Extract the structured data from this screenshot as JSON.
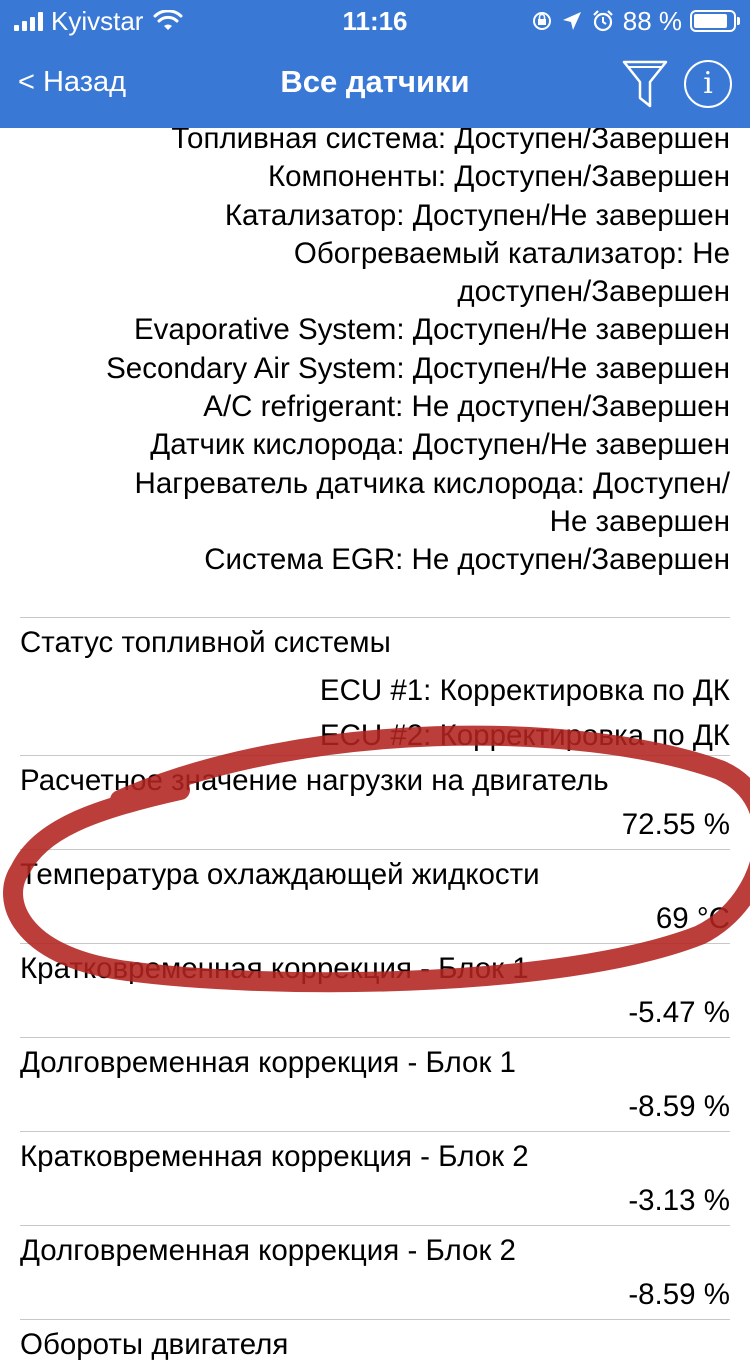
{
  "status_bar": {
    "carrier": "Kyivstar",
    "time": "11:16",
    "battery": "88 %",
    "battery_level": 0.88
  },
  "nav": {
    "back_label": "< Назад",
    "title": "Все датчики",
    "icons": [
      "filter-icon",
      "info-icon"
    ]
  },
  "monitors": [
    "Топливная система: Доступен/Завершен",
    "Компоненты: Доступен/Завершен",
    "Катализатор: Доступен/Не завершен",
    "Обогреваемый катализатор: Не",
    "доступен/Завершен",
    "Evaporative System: Доступен/Не завершен",
    "Secondary Air System: Доступен/Не завершен",
    "A/C refrigerant: Не доступен/Завершен",
    "Датчик кислорода: Доступен/Не завершен",
    "Нагреватель датчика кислорода: Доступен/",
    "Не завершен",
    "Система EGR: Не доступен/Завершен"
  ],
  "sensors": [
    {
      "label": "Статус топливной системы",
      "value": [
        "ECU #1: Корректировка по ДК",
        "ECU #2: Корректировка по ДК"
      ]
    },
    {
      "label": "Расчетное значение нагрузки на двигатель",
      "value": "72.55 %"
    },
    {
      "label": "Температура охлаждающей жидкости",
      "value": "69 °C"
    },
    {
      "label": "Кратковременная коррекция - Блок 1",
      "value": "-5.47 %"
    },
    {
      "label": "Долговременная коррекция - Блок 1",
      "value": "-8.59 %"
    },
    {
      "label": "Кратковременная коррекция - Блок 2",
      "value": "-3.13 %"
    },
    {
      "label": "Долговременная коррекция - Блок 2",
      "value": "-8.59 %"
    },
    {
      "label": "Обороты двигателя",
      "value": ""
    }
  ],
  "colors": {
    "nav_background": "#3a78d6",
    "annotation_stroke": "#b3231f"
  }
}
